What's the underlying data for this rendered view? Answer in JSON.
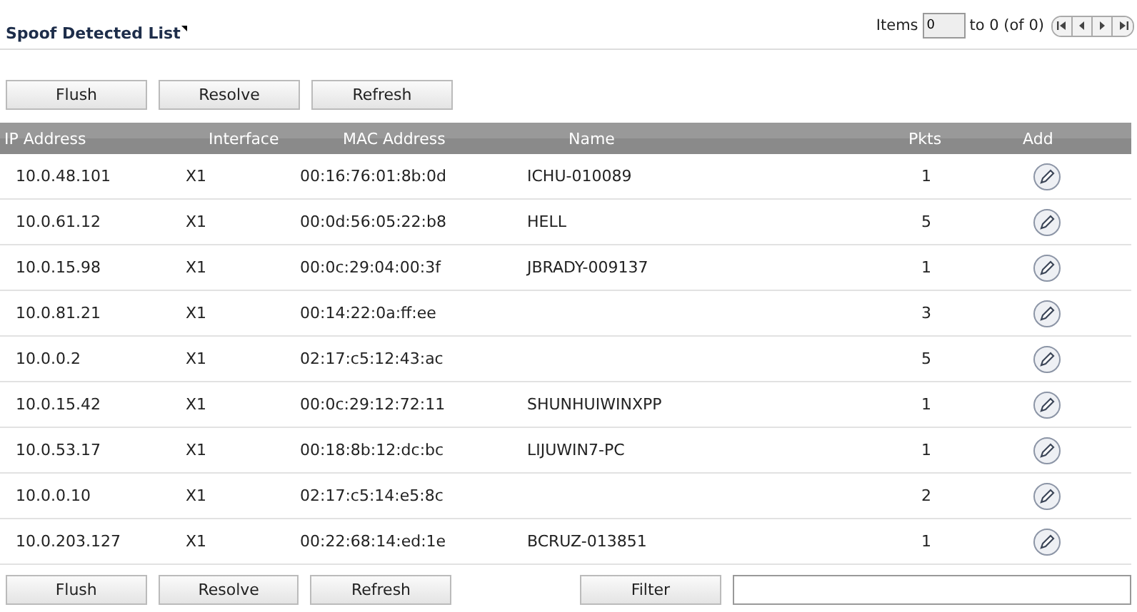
{
  "title": "Spoof Detected List",
  "pager": {
    "label": "Items",
    "value": "0",
    "range": "to 0 (of 0)"
  },
  "top_buttons": [
    "Flush",
    "Resolve",
    "Refresh"
  ],
  "columns": [
    "IP Address",
    "Interface",
    "MAC Address",
    "Name",
    "Pkts",
    "Add"
  ],
  "rows": [
    {
      "ip": "10.0.48.101",
      "interface": "X1",
      "mac": "00:16:76:01:8b:0d",
      "name": "ICHU-010089",
      "pkts": "1"
    },
    {
      "ip": "10.0.61.12",
      "interface": "X1",
      "mac": "00:0d:56:05:22:b8",
      "name": "HELL",
      "pkts": "5"
    },
    {
      "ip": "10.0.15.98",
      "interface": "X1",
      "mac": "00:0c:29:04:00:3f",
      "name": "JBRADY-009137",
      "pkts": "1"
    },
    {
      "ip": "10.0.81.21",
      "interface": "X1",
      "mac": "00:14:22:0a:ff:ee",
      "pkts": "3"
    },
    {
      "ip": "10.0.0.2",
      "interface": "X1",
      "mac": "02:17:c5:12:43:ac",
      "pkts": "5"
    },
    {
      "ip": "10.0.15.42",
      "interface": "X1",
      "mac": "00:0c:29:12:72:11",
      "name": "SHUNHUIWINXPP",
      "pkts": "1"
    },
    {
      "ip": "10.0.53.17",
      "interface": "X1",
      "mac": "00:18:8b:12:dc:bc",
      "name": "LIJUWIN7-PC",
      "pkts": "1"
    },
    {
      "ip": "10.0.0.10",
      "interface": "X1",
      "mac": "02:17:c5:14:e5:8c",
      "pkts": "2"
    },
    {
      "ip": "10.0.203.127",
      "interface": "X1",
      "mac": "00:22:68:14:ed:1e",
      "name": "BCRUZ-013851",
      "pkts": "1"
    }
  ],
  "bottom_buttons": [
    "Flush",
    "Resolve",
    "Refresh"
  ],
  "filter": {
    "button": "Filter"
  }
}
